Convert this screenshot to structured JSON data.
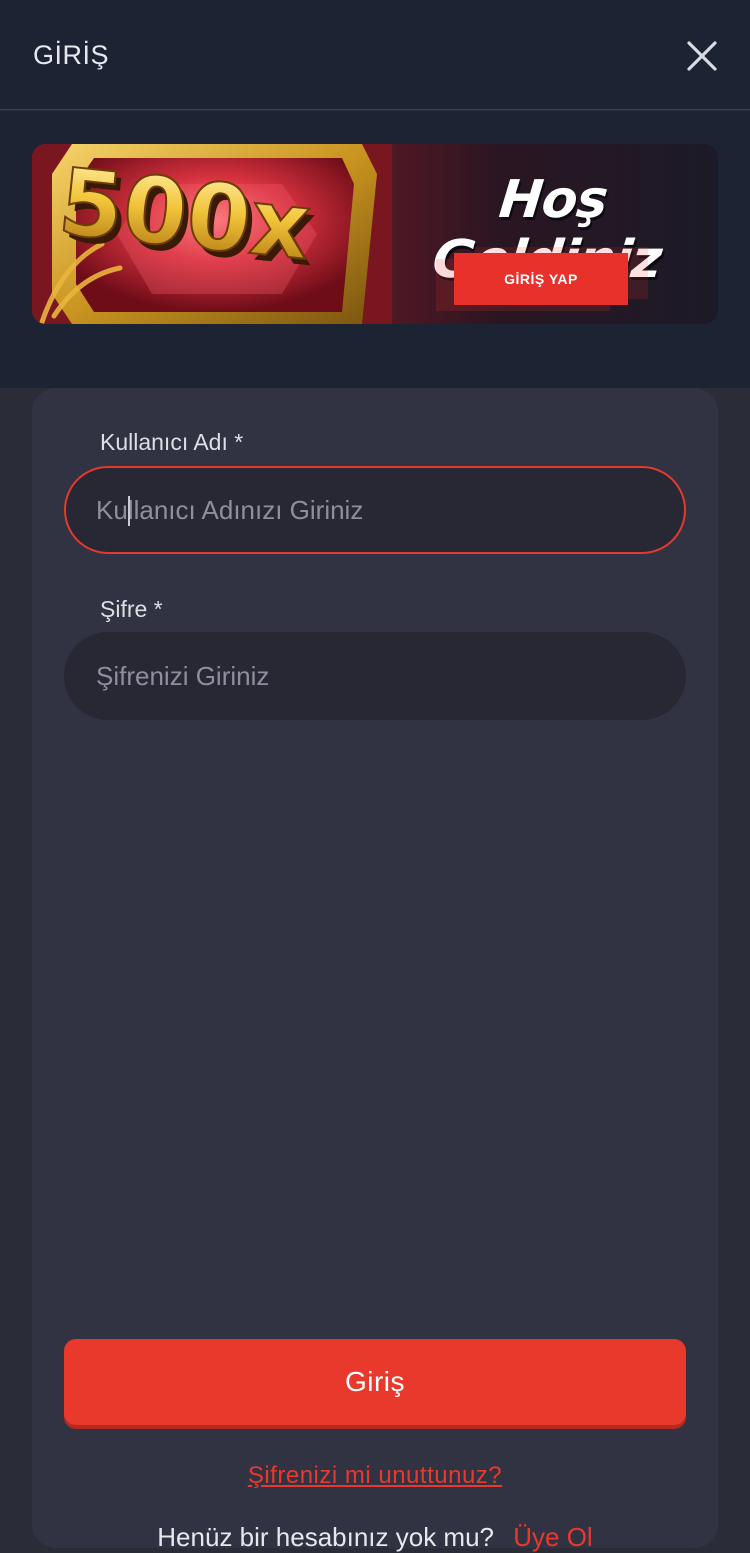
{
  "header": {
    "title": "GİRİŞ"
  },
  "banner": {
    "multiplier": "500x",
    "headline": "Hoş Geldiniz",
    "cta_label": "GİRİŞ YAP",
    "colors": {
      "accent": "#e8312a"
    }
  },
  "form": {
    "username": {
      "label": "Kullanıcı Adı *",
      "placeholder": "Kullanıcı Adınızı Giriniz",
      "value": ""
    },
    "password": {
      "label": "Şifre *",
      "placeholder": "Şifrenizi Giriniz",
      "value": ""
    },
    "submit_label": "Giriş",
    "forgot_label": "Şifrenizi mi unuttunuz?",
    "register_prompt": "Henüz bir hesabınız yok mu?",
    "register_link": "Üye Ol"
  },
  "theme": {
    "background": "#2a2c38",
    "header_bg": "#1c2333",
    "card_bg": "#313342",
    "accent": "#e8392c"
  }
}
